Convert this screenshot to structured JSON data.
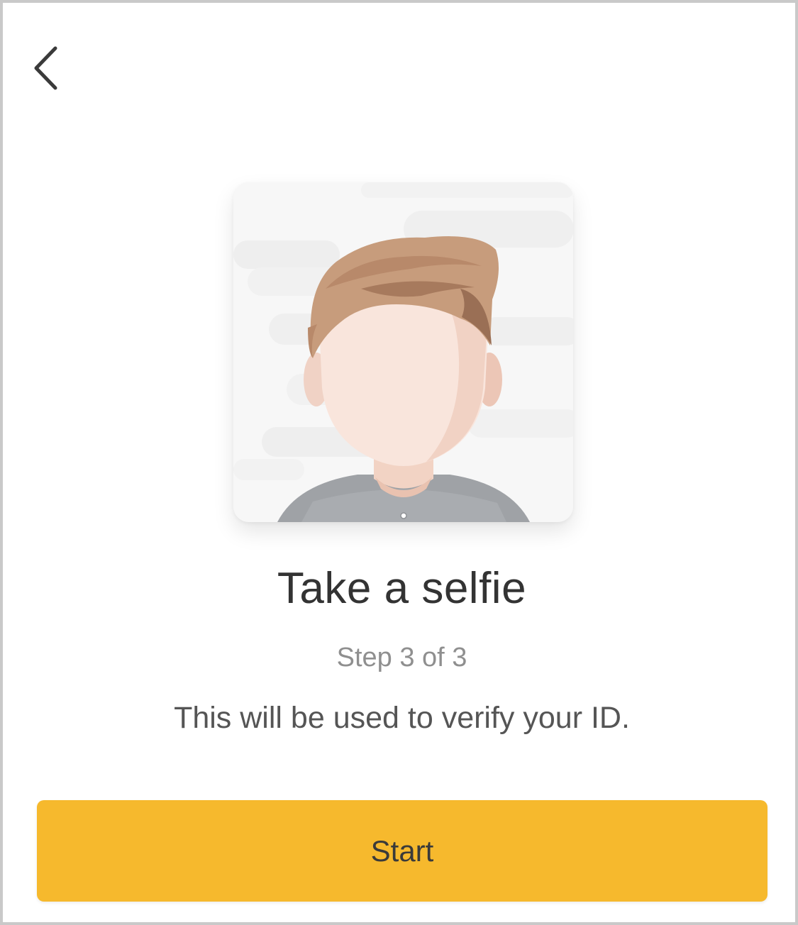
{
  "header": {
    "back_icon": "chevron-left-icon"
  },
  "illustration": {
    "icon": "selfie-avatar-illustration"
  },
  "content": {
    "title": "Take a selfie",
    "step": "Step 3 of 3",
    "description": "This will be used to verify your ID."
  },
  "actions": {
    "start_label": "Start"
  },
  "colors": {
    "accent": "#f6b92d",
    "title_text": "#333333",
    "muted_text": "#8f8f8f"
  }
}
